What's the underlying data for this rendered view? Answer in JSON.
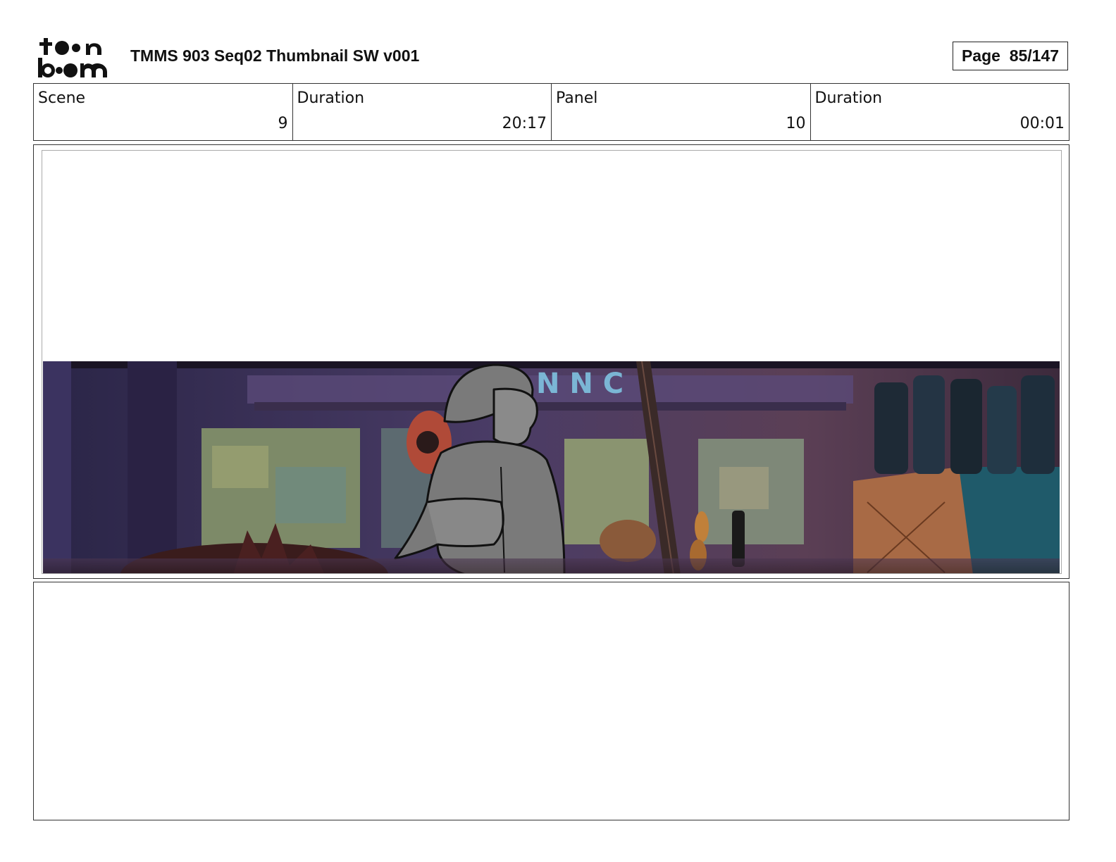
{
  "header": {
    "logo_text": "toon boom",
    "title": "TMMS 903 Seq02 Thumbnail SW v001",
    "page_label": "Page  85/147"
  },
  "info": {
    "cells": [
      {
        "label": "Scene",
        "value": "9"
      },
      {
        "label": "Duration",
        "value": "20:17"
      },
      {
        "label": "Panel",
        "value": "10"
      },
      {
        "label": "Duration",
        "value": "00:01"
      }
    ]
  },
  "panel": {
    "sign_letters": "N N C",
    "colors": {
      "wall": "#3b2f57",
      "window": "#7c8a6a",
      "character_fill": "#7a7a7a",
      "crate": "#a86a45",
      "bottles": "#1e2a36"
    }
  },
  "notes": {
    "text": ""
  }
}
